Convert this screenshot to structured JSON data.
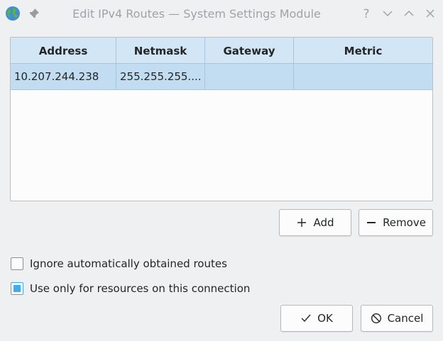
{
  "window": {
    "title": "Edit IPv4 Routes — System Settings Module"
  },
  "colors": {
    "accent": "#3daee9",
    "header_bg": "#d3e6f6",
    "selected_row_bg": "#c2dcf2"
  },
  "table": {
    "columns": [
      "Address",
      "Netmask",
      "Gateway",
      "Metric"
    ],
    "rows": [
      {
        "address": "10.207.244.238",
        "netmask": "255.255.255....",
        "gateway": "",
        "metric": ""
      }
    ]
  },
  "buttons": {
    "add": "Add",
    "remove": "Remove",
    "ok": "OK",
    "cancel": "Cancel"
  },
  "options": {
    "ignore_auto_routes": {
      "label": "Ignore automatically obtained routes",
      "checked": false
    },
    "use_only_for_resources": {
      "label": "Use only for resources on this connection",
      "checked": true
    }
  },
  "icons": {
    "app": "globe-icon",
    "pin": "pin-icon",
    "help": "help-icon",
    "minimize": "chevron-down-icon",
    "maximize": "chevron-up-icon",
    "close": "close-icon",
    "add": "plus-icon",
    "remove": "minus-icon",
    "ok": "checkmark-icon",
    "cancel": "cancel-icon"
  }
}
